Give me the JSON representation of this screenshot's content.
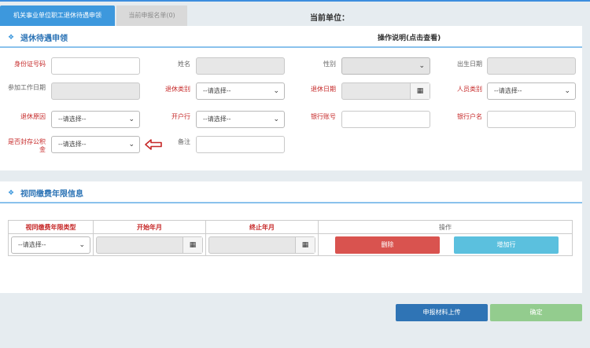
{
  "tabs": [
    {
      "label": "机关事业单位职工退休待遇申领",
      "active": true
    },
    {
      "label": "当前申报名单(0)",
      "active": false
    }
  ],
  "unit_label": "当前单位：",
  "retire_section": {
    "title": "退休待遇申领",
    "instructions": "操作说明(点击查看)",
    "labels": {
      "id_number": "身份证号码",
      "name": "姓名",
      "gender": "性别",
      "birth_date": "出生日期",
      "work_start_date": "参加工作日期",
      "retire_type": "退休类别",
      "retire_date": "退休日期",
      "person_type": "人员类别",
      "retire_reason": "退休原因",
      "bank": "开户行",
      "bank_account": "银行账号",
      "account_name": "银行户名",
      "housing_fund": "是否封存公积金",
      "remarks": "备注"
    },
    "placeholder": "--请选择--"
  },
  "contrib_section": {
    "title": "视同缴费年限信息",
    "columns": [
      "视同缴费年限类型",
      "开始年月",
      "终止年月",
      "操作"
    ],
    "row_select": "--请选择--",
    "delete_label": "删除",
    "add_label": "增加行"
  },
  "footer": {
    "upload_label": "申报材料上传",
    "confirm_label": "确定"
  },
  "colors": {
    "primary": "#3d98dd",
    "required_label": "#c62828",
    "delete": "#d9534f",
    "add": "#5bc0de",
    "upload": "#2f74b5",
    "confirm": "#93cc8e"
  },
  "icons": {
    "calendar": "calendar-icon",
    "arrow": "left-arrow-icon",
    "section": "diamond-icon"
  }
}
